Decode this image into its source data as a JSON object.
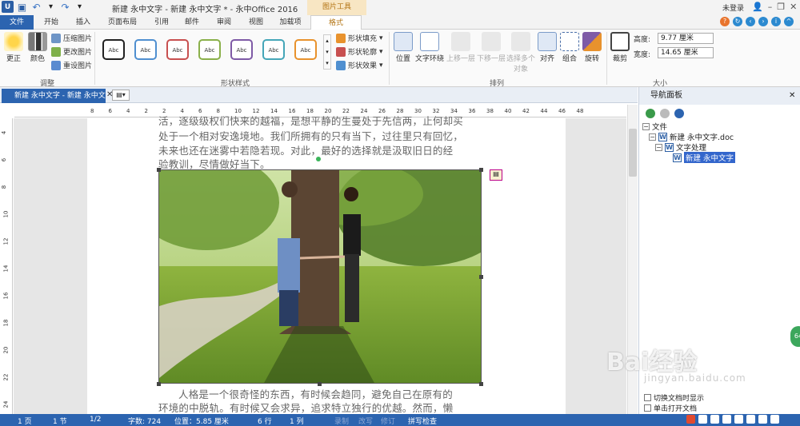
{
  "titlebar": {
    "doc_title": "新建 永中文字 - 新建 永中文字 * - 永中Office 2016",
    "context_group": "图片工具",
    "user": "未登录"
  },
  "tabs": [
    "文件",
    "开始",
    "插入",
    "页面布局",
    "引用",
    "邮件",
    "审阅",
    "视图",
    "加载项",
    "格式"
  ],
  "ribbon": {
    "adjust": {
      "brighten": "更正",
      "color": "颜色",
      "compress": "压缩图片",
      "change": "更改图片",
      "reset": "重设图片",
      "label": "调整"
    },
    "shape_styles": {
      "swatch_text": "Abc",
      "fill": "形状填充",
      "outline": "形状轮廓",
      "effects": "形状效果",
      "label": "形状样式"
    },
    "arrange": {
      "position": "位置",
      "wrap": "文字环绕",
      "forward": "上移一层",
      "backward": "下移一层",
      "select_multi": "选择多个对象",
      "align": "对齐",
      "group": "组合",
      "rotate": "旋转",
      "label": "排列"
    },
    "size": {
      "crop": "裁剪",
      "height_label": "高度:",
      "height_value": "9.77 厘米",
      "width_label": "宽度:",
      "width_value": "14.65 厘米",
      "label": "大小"
    }
  },
  "doc_tab": {
    "title": "新建 永中文字 - 新建 永中文字"
  },
  "ruler": {
    "h_ticks": [
      "8",
      "6",
      "4",
      "2",
      "2",
      "4",
      "6",
      "8",
      "10",
      "12",
      "14",
      "16",
      "18",
      "20",
      "22",
      "24",
      "26",
      "28",
      "30",
      "32",
      "34",
      "36",
      "38",
      "40",
      "42",
      "44",
      "46",
      "48"
    ],
    "v_ticks": [
      "4",
      "6",
      "8",
      "10",
      "12",
      "14",
      "16",
      "18",
      "20",
      "22",
      "24"
    ]
  },
  "document": {
    "para_top_1": "活，逐级级权们快来的越福，是想平静的生曼处于先信两，止何却买",
    "para_top_2": "处于一个相对安逸境地。我们所拥有的只有当下，过往里只有回忆，",
    "para_top_3": "未来也还在迷雾中若隐若现。对此，最好的选择就是汲取旧日的经",
    "para_top_4": "验教训，尽情做好当下。",
    "para_bot_1": "人格是一个很奇怪的东西，有时候会趋同，避免自己在原有的",
    "para_bot_2": "环境的中脱轨。有时候又会求异，追求特立独行的优越。然而，懒"
  },
  "nav": {
    "title": "导航面板",
    "root": "文件",
    "doc": "新建 永中文字.doc",
    "section": "文字处理",
    "item": "新建 永中文字",
    "opt1": "切换文档时显示",
    "opt2": "单击打开文档"
  },
  "watermark": {
    "text": "Bai经验",
    "url": "jingyan.baidu.com"
  },
  "status": {
    "page": "1 页",
    "section": "1 节",
    "page_of": "1/2",
    "word_count": "字数: 724",
    "position": "位置：5.85 厘米",
    "row": "6 行",
    "col": "1 列",
    "record": "录制",
    "revise": "改写",
    "track": "修订",
    "spell": "拼写检查"
  },
  "colors": {
    "accent": "#2c64b0",
    "context_tab": "#b37413"
  }
}
